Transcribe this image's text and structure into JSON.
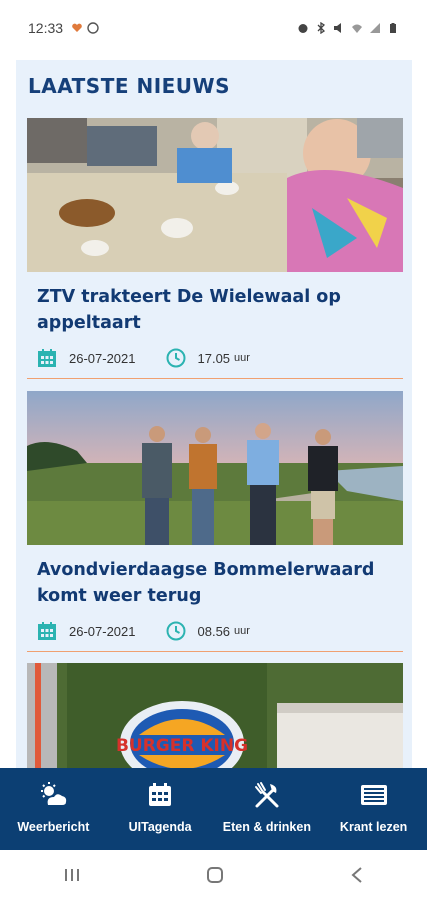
{
  "status": {
    "time": "12:33"
  },
  "section": {
    "title": "LAATSTE NIEUWS"
  },
  "articles": [
    {
      "headline": "ZTV trakteert De Wielewaal op appeltaart",
      "date": "26-07-2021",
      "time": "17.05",
      "time_unit": "uur"
    },
    {
      "headline": "Avondvierdaagse Bommelerwaard komt weer terug",
      "date": "26-07-2021",
      "time": "08.56",
      "time_unit": "uur"
    },
    {
      "sign_text": "BURGER KING"
    }
  ],
  "nav": [
    {
      "label": "Weerbericht",
      "icon": "weather-icon"
    },
    {
      "label": "UITagenda",
      "icon": "calendar-icon"
    },
    {
      "label": "Eten & drinken",
      "icon": "fork-knife-icon"
    },
    {
      "label": "Krant lezen",
      "icon": "newspaper-icon"
    }
  ],
  "colors": {
    "accent": "#2bb3b1",
    "brand": "#0c3f73",
    "divider": "#f0a070",
    "panel": "#e8f1fb"
  }
}
